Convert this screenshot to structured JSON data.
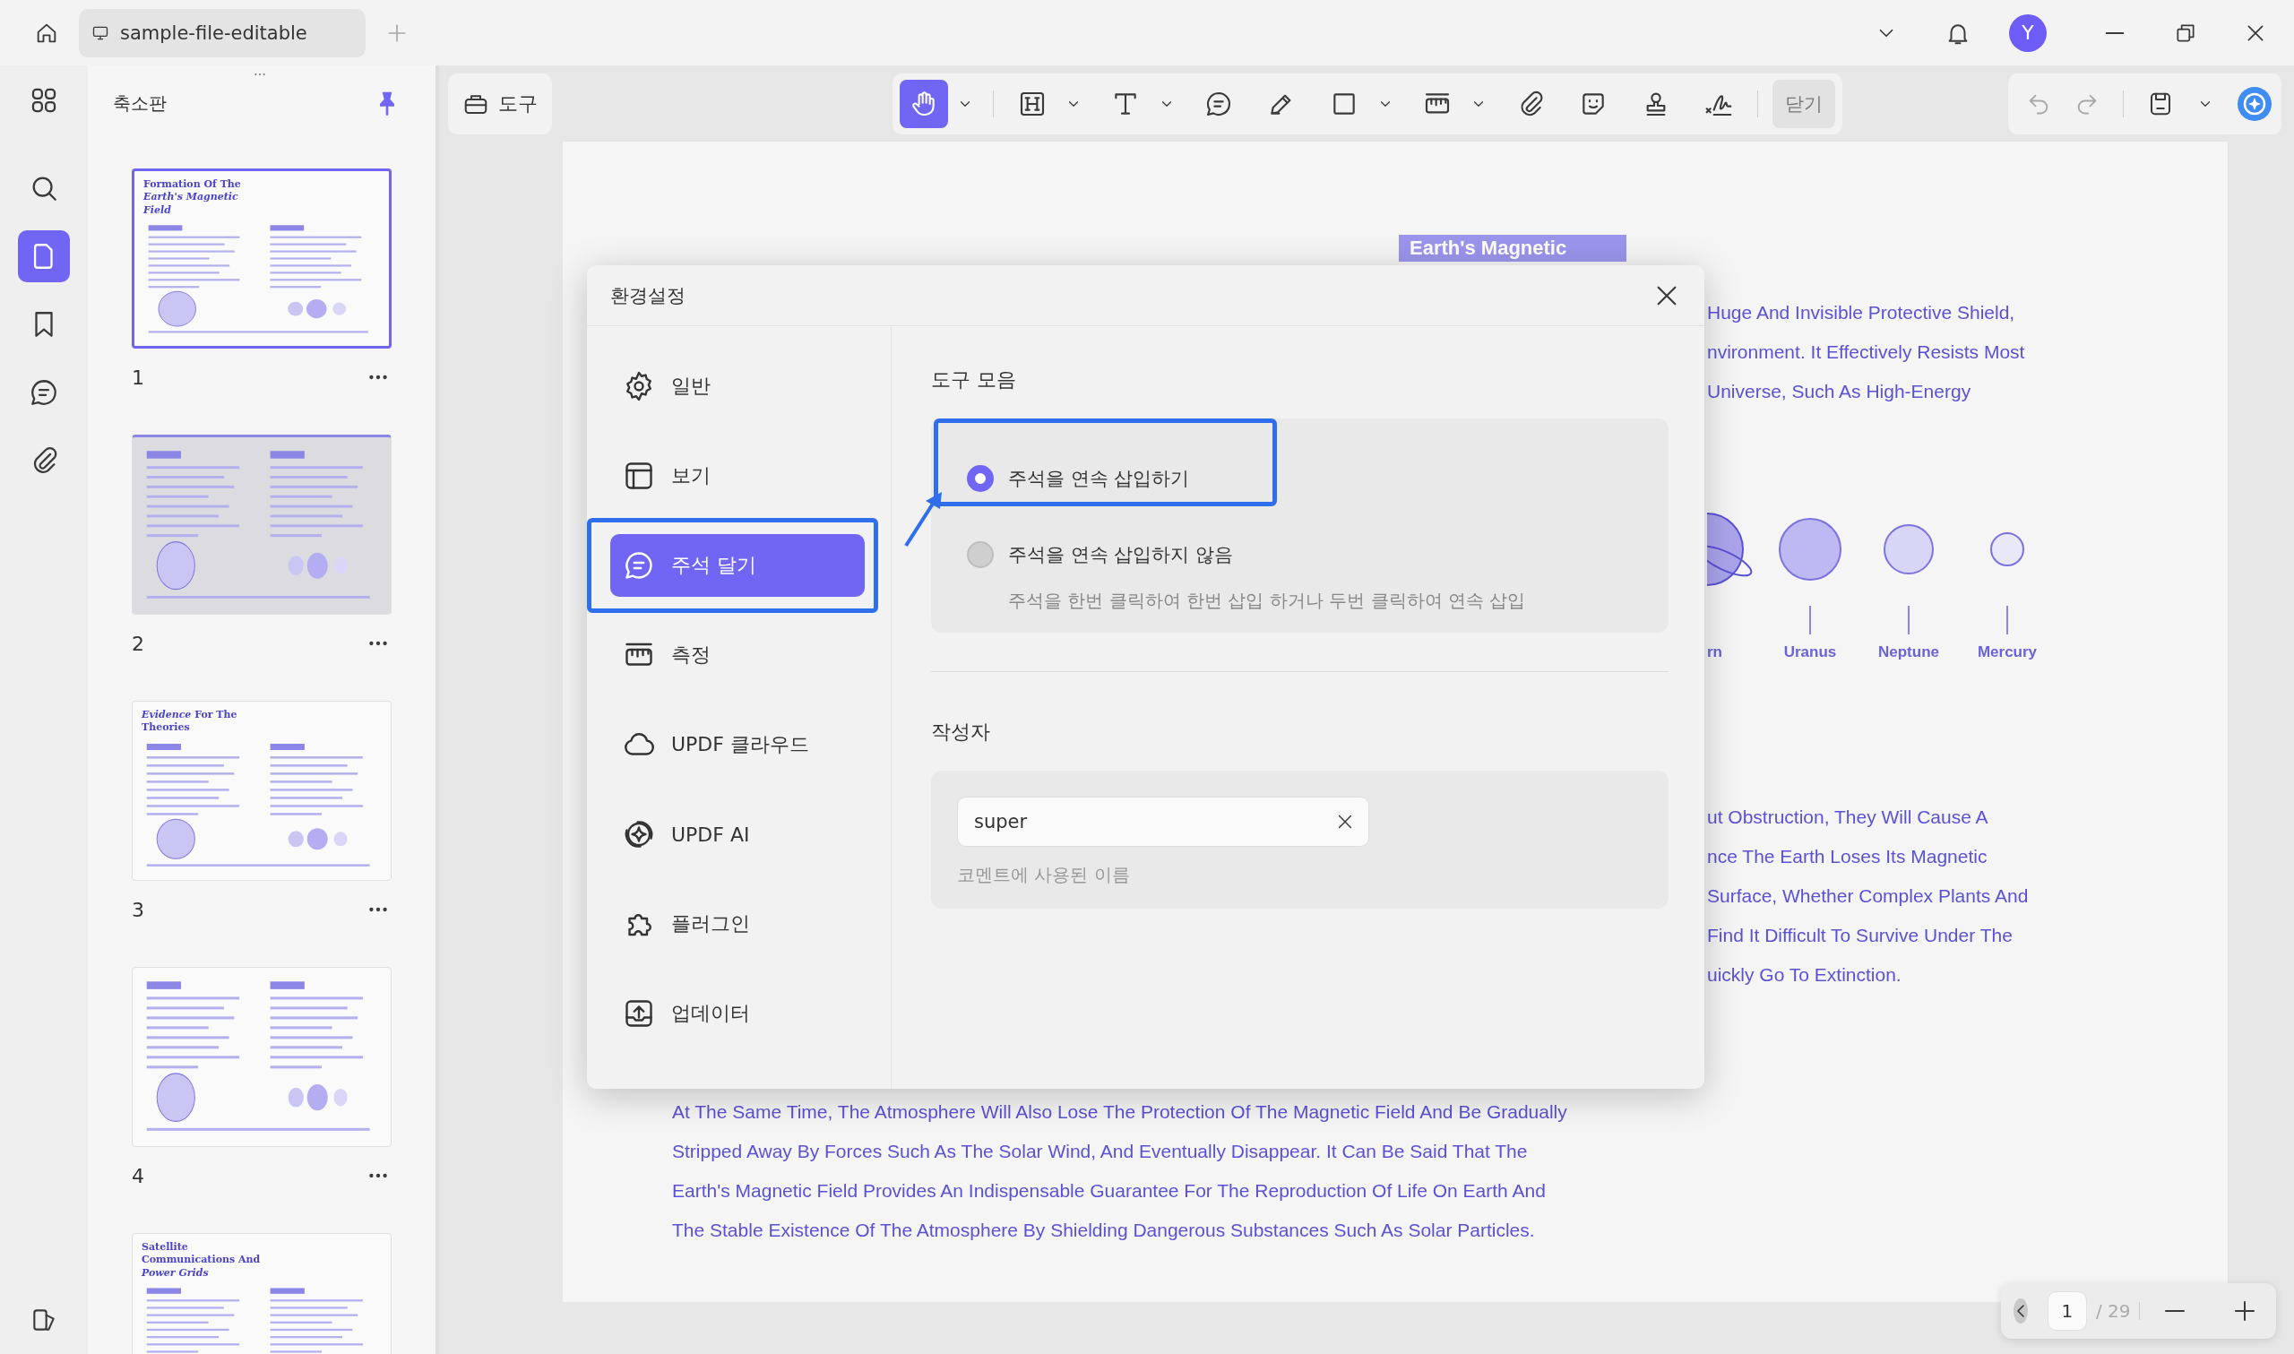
{
  "titlebar": {
    "tab_title": "sample-file-editable",
    "avatar_initial": "Y"
  },
  "rail": [
    {
      "kind": "grid",
      "selected": false
    },
    {
      "kind": "search",
      "selected": false
    },
    {
      "kind": "page",
      "selected": true
    },
    {
      "kind": "bookmark",
      "selected": false
    },
    {
      "kind": "comment",
      "selected": false
    },
    {
      "kind": "paperclip",
      "selected": false
    }
  ],
  "thumbnails": {
    "title": "축소판",
    "pages": [
      {
        "number": "1",
        "selected": true,
        "hovered": false,
        "title": "Formation Of The *Earth's Magnetic Field*"
      },
      {
        "number": "2",
        "selected": false,
        "hovered": true
      },
      {
        "number": "3",
        "selected": false,
        "hovered": false,
        "title": "*Evidence* For The Theories"
      },
      {
        "number": "4",
        "selected": false,
        "hovered": false
      },
      {
        "selected": false,
        "hovered": false,
        "title": "Satellite Communications And *Power Grids*"
      }
    ]
  },
  "toolbar": {
    "tool_label": "도구",
    "close_label": "닫기",
    "tools": [
      {
        "kind": "hand",
        "selected": true,
        "caret": true
      },
      {
        "kind": "heading",
        "selected": false,
        "caret": true
      },
      {
        "kind": "text",
        "selected": false,
        "caret": true
      },
      {
        "kind": "comment",
        "selected": false,
        "caret": false
      },
      {
        "kind": "pen",
        "selected": false,
        "caret": false
      },
      {
        "kind": "rectangle",
        "selected": false,
        "caret": true
      },
      {
        "kind": "ruler",
        "selected": false,
        "caret": true
      },
      {
        "kind": "paperclip",
        "selected": false,
        "caret": false
      },
      {
        "kind": "sticker",
        "selected": false,
        "caret": false
      },
      {
        "kind": "stamp",
        "selected": false,
        "caret": false
      },
      {
        "kind": "signature",
        "selected": false,
        "caret": false
      }
    ]
  },
  "page": {
    "tag": "Earth's Magnetic",
    "right_lines_top": [
      "Huge And Invisible Protective Shield,",
      "nvironment. It Effectively Resists Most",
      "Universe, Such As High-Energy"
    ],
    "planets": [
      {
        "label": "rn",
        "kind": "ringed",
        "color": "#aaa4ec"
      },
      {
        "label": "Uranus",
        "kind": "plain",
        "color": "#bdb9f3"
      },
      {
        "label": "Neptune",
        "kind": "plain",
        "color": "#d8d6f6"
      },
      {
        "label": "Mercury",
        "kind": "plain",
        "color": "#e9e8f8"
      }
    ],
    "right_lines_bottom": [
      "ut Obstruction, They Will Cause A",
      "nce The Earth Loses Its Magnetic",
      "Surface, Whether Complex Plants And",
      "Find It Difficult To Survive Under The",
      "uickly Go To Extinction."
    ],
    "bottom_lines": [
      "At The Same Time, The Atmosphere Will Also Lose The Protection Of The Magnetic Field And Be Gradually",
      "Stripped Away By Forces Such As The Solar Wind, And Eventually Disappear. It Can Be Said That The",
      "Earth's Magnetic Field Provides An Indispensable Guarantee For The Reproduction Of Life On Earth And",
      "The Stable Existence Of The Atmosphere By Shielding Dangerous Substances Such As Solar Particles."
    ]
  },
  "dialog": {
    "title": "환경설정",
    "nav": [
      {
        "label": "일반",
        "kind": "gear",
        "selected": false,
        "highlighted": false
      },
      {
        "label": "보기",
        "kind": "layout",
        "selected": false,
        "highlighted": false
      },
      {
        "label": "주석 달기",
        "kind": "comment",
        "selected": true,
        "highlighted": true
      },
      {
        "label": "측정",
        "kind": "ruler",
        "selected": false,
        "highlighted": false
      },
      {
        "label": "UPDF 클라우드",
        "kind": "cloud",
        "selected": false,
        "highlighted": false
      },
      {
        "label": "UPDF AI",
        "kind": "sparkle",
        "selected": false,
        "highlighted": false
      },
      {
        "label": "플러그인",
        "kind": "puzzle",
        "selected": false,
        "highlighted": false
      },
      {
        "label": "업데이터",
        "kind": "update",
        "selected": false,
        "highlighted": false
      }
    ],
    "toolbar_section": {
      "heading": "도구 모음",
      "options": [
        {
          "label": "주석을 연속 삽입하기",
          "selected": true,
          "highlighted": true
        },
        {
          "label": "주석을 연속 삽입하지 않음",
          "selected": false,
          "highlighted": false
        }
      ],
      "description": "주석을 한번 클릭하여 한번 삽입 하거나 두번 클릭하여 연속 삽입"
    },
    "author_section": {
      "heading": "작성자",
      "value": "super",
      "helper": "코멘트에 사용된 이름"
    }
  },
  "pager": {
    "page_value": "1",
    "total": "/ 29"
  }
}
